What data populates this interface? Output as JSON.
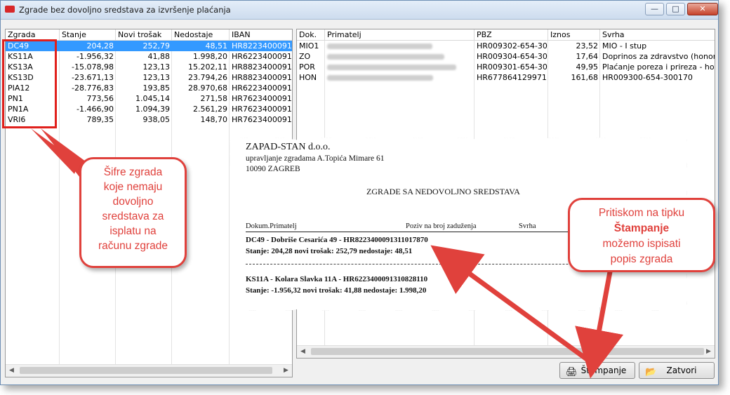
{
  "window": {
    "title": "Zgrade bez dovoljno sredstava za izvršenje plaćanja"
  },
  "left_table": {
    "headers": [
      "Zgrada",
      "Stanje",
      "Novi trošak",
      "Nedostaje",
      "IBAN"
    ],
    "rows": [
      {
        "zgrada": "DC49",
        "stanje": "204,28",
        "trosak": "252,79",
        "nedostaje": "48,51",
        "iban": "HR8223400091"
      },
      {
        "zgrada": "KS11A",
        "stanje": "-1.956,32",
        "trosak": "41,88",
        "nedostaje": "1.998,20",
        "iban": "HR6223400091"
      },
      {
        "zgrada": "KS13A",
        "stanje": "-15.078,98",
        "trosak": "123,13",
        "nedostaje": "15.202,11",
        "iban": "HR8823400091"
      },
      {
        "zgrada": "KS13D",
        "stanje": "-23.671,13",
        "trosak": "123,13",
        "nedostaje": "23.794,26",
        "iban": "HR8823400091"
      },
      {
        "zgrada": "PIA12",
        "stanje": "-28.776,83",
        "trosak": "193,85",
        "nedostaje": "28.970,68",
        "iban": "HR6223400091"
      },
      {
        "zgrada": "PN1",
        "stanje": "773,56",
        "trosak": "1.045,14",
        "nedostaje": "271,58",
        "iban": "HR7623400091"
      },
      {
        "zgrada": "PN1A",
        "stanje": "-1.466,90",
        "trosak": "1.094,39",
        "nedostaje": "2.561,29",
        "iban": "HR7623400091"
      },
      {
        "zgrada": "VRI6",
        "stanje": "789,35",
        "trosak": "938,05",
        "nedostaje": "148,70",
        "iban": "HR7623400091"
      }
    ]
  },
  "right_table": {
    "headers": [
      "Dok.",
      "Primatelj",
      "PBZ",
      "Iznos",
      "Svrha"
    ],
    "rows": [
      {
        "dok": "MIO1",
        "pbz": "HR009302-654-30",
        "iznos": "23,52",
        "svrha": "MIO - I stup"
      },
      {
        "dok": "ZO",
        "pbz": "HR009304-654-30",
        "iznos": "17,64",
        "svrha": "Doprinos za zdravstvo (honor"
      },
      {
        "dok": "POR",
        "pbz": "HR009301-654-30",
        "iznos": "49,95",
        "svrha": "Plaćanje poreza i prireza - ho"
      },
      {
        "dok": "HON",
        "pbz": "HR677864129971",
        "iznos": "161,68",
        "svrha": "HR009300-654-300170"
      }
    ]
  },
  "preview": {
    "company": "ZAPAD-STAN d.o.o.",
    "line2": "upravljanje zgradama A.Topića Mimare 61",
    "line3": "10090 ZAGREB",
    "report_title": "ZGRADE SA NEDOVOLJNO SREDSTAVA",
    "col_dok": "Dokum.Primatelj",
    "col_poziv": "Poziv na broj zaduženja",
    "col_svrha": "Svrha",
    "entry1_head": "DC49 - Dobriše Cesarića 49 - HR8223400091311017870",
    "entry1_stats": "Stanje: 204,28  novi trošak: 252,79  nedostaje: 48,51",
    "entry2_head": "KS11A - Kolara Slavka 11A - HR6223400091310828110",
    "entry2_stats": "Stanje: -1.956,32  novi trošak: 41,88  nedostaje: 1.998,20"
  },
  "callout_left": {
    "lines": [
      "Šifre zgrada",
      "koje nemaju",
      "dovoljno",
      "sredstava za",
      "isplatu na",
      "računu zgrade"
    ]
  },
  "callout_right": {
    "line1": "Pritiskom na tipku",
    "line2": "Štampanje",
    "line3": "možemo ispisati",
    "line4": "popis zgrada"
  },
  "buttons": {
    "print": "Štampanje",
    "close": "Zatvori"
  },
  "colors": {
    "accent_red": "#e0413c",
    "selection": "#3399ff"
  }
}
